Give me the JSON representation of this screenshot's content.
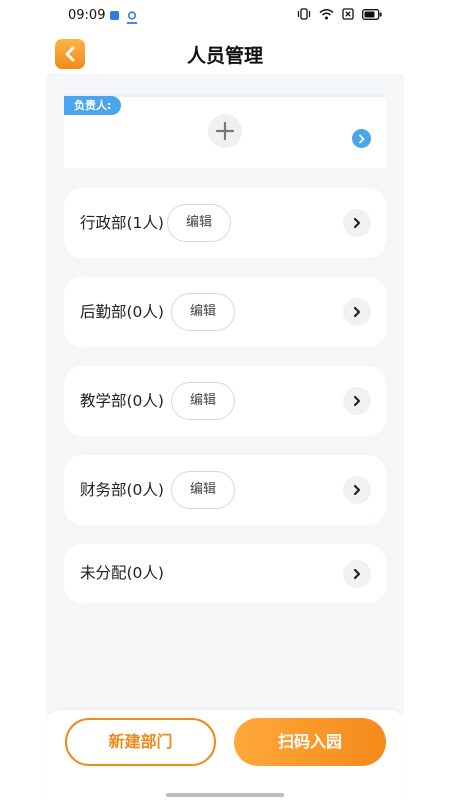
{
  "status_bar": {
    "time": "09:09",
    "icons": [
      "app-icon",
      "app-icon",
      "vibrate-icon",
      "wifi-icon",
      "sim-icon",
      "battery-icon"
    ]
  },
  "header": {
    "title": "人员管理",
    "back_icon": "chevron-left-icon",
    "accent_color": "#f08a1c"
  },
  "leader": {
    "label": "负责人:",
    "add_icon": "plus-icon",
    "more_icon": "chevron-right-icon",
    "tag_color": "#4aa5ec"
  },
  "departments": [
    {
      "name": "行政部(1人)",
      "edit_label": "编辑"
    },
    {
      "name": "后勤部(0人)",
      "edit_label": "编辑"
    },
    {
      "name": "教学部(0人)",
      "edit_label": "编辑"
    },
    {
      "name": "财务部(0人)",
      "edit_label": "编辑"
    },
    {
      "name": "未分配(0人)"
    }
  ],
  "actions": {
    "new_department": "新建部门",
    "scan_join": "扫码入园"
  }
}
